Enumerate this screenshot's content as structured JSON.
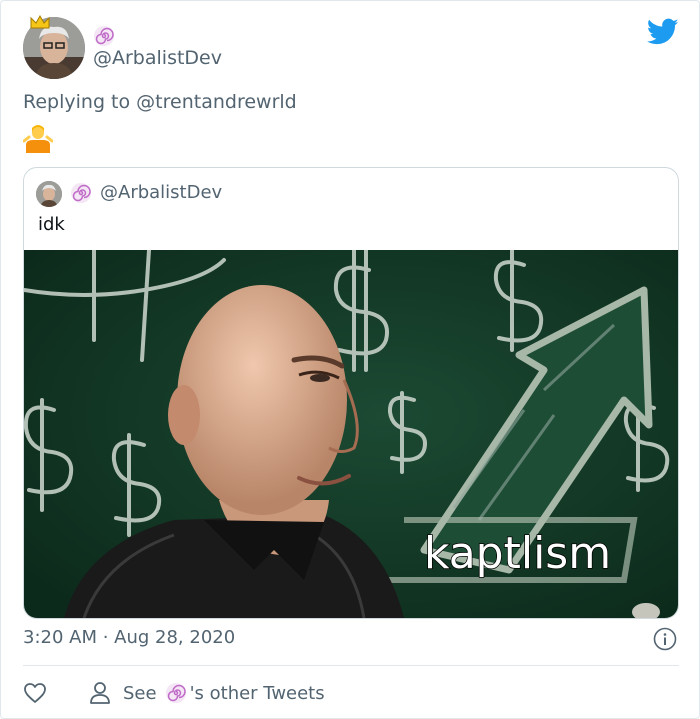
{
  "tweet": {
    "author_handle": "@ArbalistDev",
    "reply_prefix": "Replying to",
    "reply_mention": "@trentandrewrld",
    "timestamp": "3:20 AM · Aug 28, 2020"
  },
  "quoted_tweet": {
    "author_handle": "@ArbalistDev",
    "text": "idk",
    "image_caption": "kaptlism"
  },
  "footer": {
    "see_label": "See",
    "other_tweets_label": "'s other Tweets"
  },
  "colors": {
    "twitter_blue": "#1d9bf0",
    "secondary_text": "#536471",
    "chalkboard": "#123826"
  },
  "icons": [
    "twitter-bird-icon",
    "swirl-emoji-icon",
    "shrug-emoji-icon",
    "info-icon",
    "heart-icon",
    "person-icon",
    "crown-icon"
  ]
}
